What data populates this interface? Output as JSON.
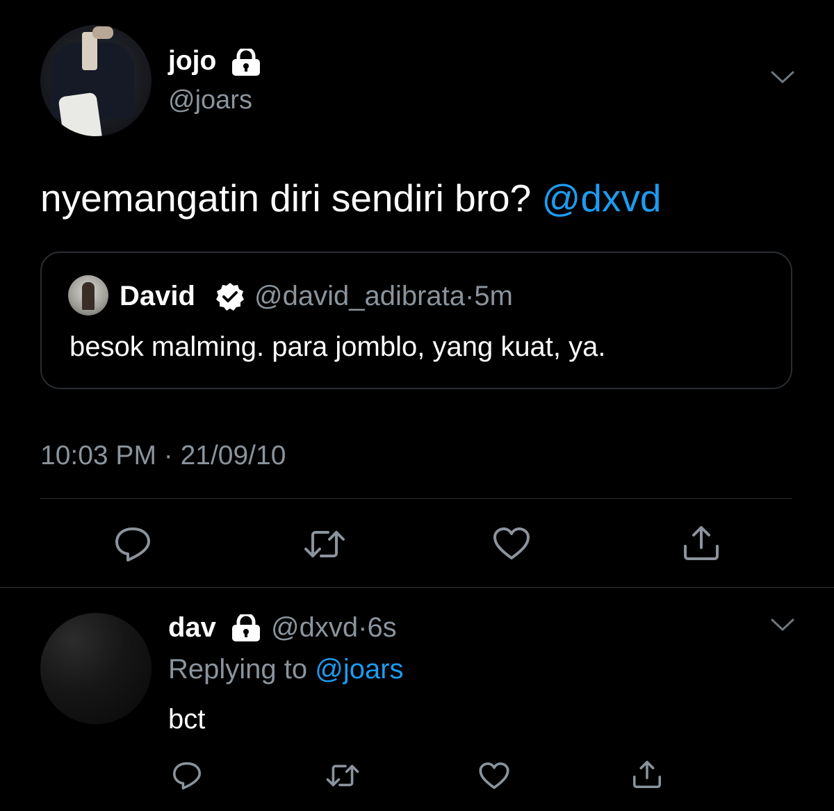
{
  "tweet": {
    "display_name": "jojo",
    "handle": "@joars",
    "text": "nyemangatin diri sendiri bro? ",
    "mention": "@dxvd",
    "timestamp": "10:03 PM · 21/09/10",
    "icons": {
      "lock": "lock-icon",
      "more": "chevron-down-icon"
    }
  },
  "quote": {
    "display_name": "David",
    "handle": "@david_adibrata",
    "separator": "·",
    "time": "5m",
    "text": "besok malming. para jomblo, yang kuat, ya.",
    "verified_icon": "verified-badge-icon"
  },
  "actions": {
    "icons": [
      "reply-icon",
      "retweet-icon",
      "like-icon",
      "share-icon"
    ]
  },
  "reply": {
    "display_name": "dav",
    "handle": "@dxvd",
    "separator": "·",
    "time": "6s",
    "replying_label": "Replying to ",
    "replying_to": "@joars",
    "text": "bct"
  },
  "colors": {
    "background": "#000000",
    "text": "#ffffff",
    "muted": "#8b949c",
    "accent": "#1d9bf0",
    "border": "#2f3336"
  }
}
